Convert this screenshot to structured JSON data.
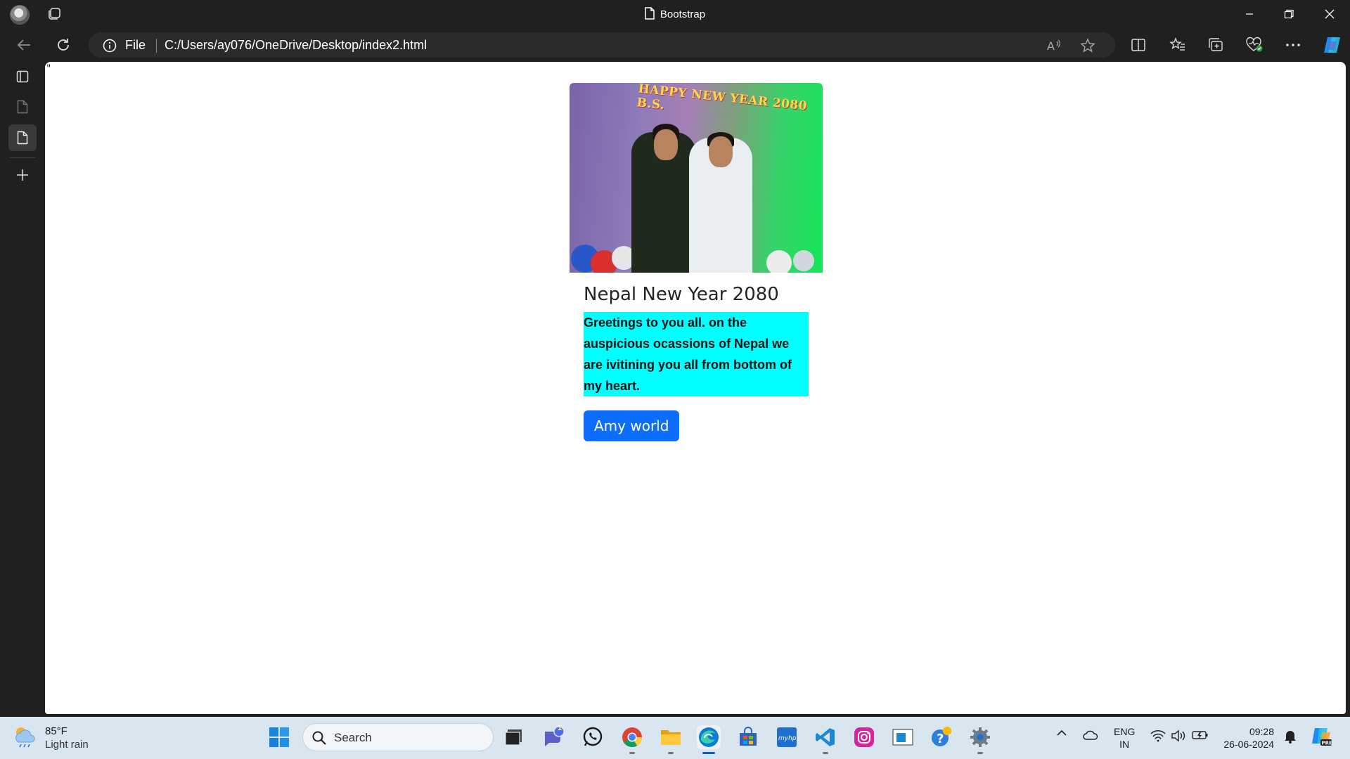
{
  "window": {
    "title": "Bootstrap"
  },
  "addressbar": {
    "scheme_label": "File",
    "url": "C:/Users/ay076/OneDrive/Desktop/index2.html"
  },
  "page": {
    "stray_text": "\"",
    "card": {
      "image_banner_text": "HAPPY NEW YEAR 2080 B.S.",
      "title": "Nepal New Year 2080",
      "text": "Greetings to you all. on the auspicious ocassions of Nepal we are ivitining you all from bottom of my heart.",
      "button_label": "Amy world",
      "text_highlight_color": "#00ffff",
      "button_color": "#0d6efd"
    }
  },
  "taskbar": {
    "weather": {
      "temp": "85°F",
      "condition": "Light rain"
    },
    "search_placeholder": "Search",
    "teams_badge": "1",
    "language": {
      "line1": "ENG",
      "line2": "IN"
    },
    "clock": {
      "time": "09:28",
      "date": "26-06-2024"
    },
    "apps": [
      "file-explorer-task-view",
      "teams-chat",
      "whatsapp",
      "chrome",
      "file-explorer",
      "edge",
      "microsoft-store",
      "myhp",
      "vscode",
      "instagram",
      "app-window",
      "get-help",
      "settings"
    ]
  }
}
